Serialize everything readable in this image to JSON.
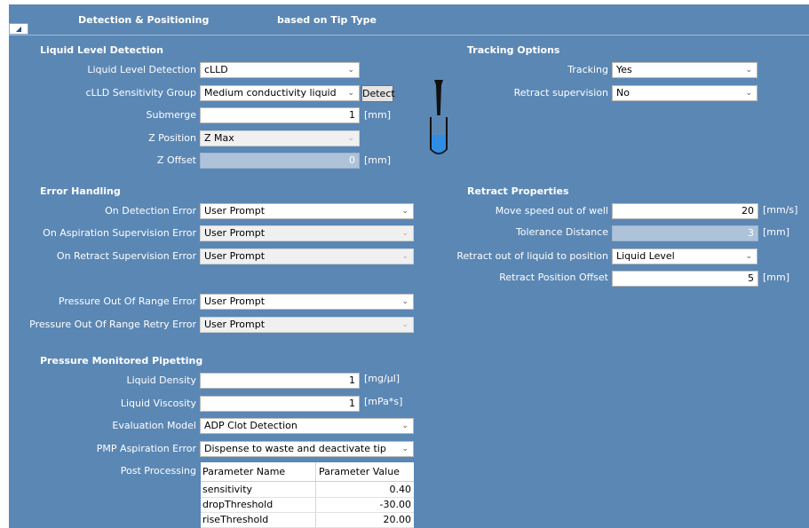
{
  "header": {
    "title": "Detection & Positioning",
    "subtitle": "based on Tip Type",
    "collapse_glyph": "◢"
  },
  "lld": {
    "section": "Liquid Level Detection",
    "detection_label": "Liquid Level Detection",
    "detection_value": "cLLD",
    "sensitivity_label": "cLLD Sensitivity Group",
    "sensitivity_value": "Medium conductivity liquid",
    "detect_button": "Detect",
    "submerge_label": "Submerge",
    "submerge_value": "1",
    "submerge_unit": "[mm]",
    "zpos_label": "Z Position",
    "zpos_value": "Z Max",
    "zoffset_label": "Z Offset",
    "zoffset_value": "0",
    "zoffset_unit": "[mm]"
  },
  "tracking": {
    "section": "Tracking Options",
    "tracking_label": "Tracking",
    "tracking_value": "Yes",
    "retract_sup_label": "Retract supervision",
    "retract_sup_value": "No"
  },
  "errors": {
    "section": "Error Handling",
    "items": [
      {
        "label": "On Detection Error",
        "value": "User Prompt"
      },
      {
        "label": "On Aspiration Supervision Error",
        "value": "User Prompt"
      },
      {
        "label": "On Retract Supervision Error",
        "value": "User Prompt"
      },
      {
        "label": "Pressure Out Of Range Error",
        "value": "User Prompt"
      },
      {
        "label": "Pressure Out Of Range Retry Error",
        "value": "User Prompt"
      }
    ]
  },
  "retract": {
    "section": "Retract Properties",
    "speed_label": "Move speed out of well",
    "speed_value": "20",
    "speed_unit": "[mm/s]",
    "tolerance_label": "Tolerance Distance",
    "tolerance_value": "3",
    "tolerance_unit": "[mm]",
    "position_label": "Retract out of liquid to position",
    "position_value": "Liquid Level",
    "offset_label": "Retract Position Offset",
    "offset_value": "5",
    "offset_unit": "[mm]"
  },
  "pmp": {
    "section": "Pressure Monitored Pipetting",
    "density_label": "Liquid Density",
    "density_value": "1",
    "density_unit": "[mg/µl]",
    "viscosity_label": "Liquid Viscosity",
    "viscosity_value": "1",
    "viscosity_unit": "[mPa*s]",
    "model_label": "Evaluation Model",
    "model_value": "ADP Clot Detection",
    "asp_error_label": "PMP Aspiration Error",
    "asp_error_value": "Dispense to waste and deactivate tip",
    "post_label": "Post Processing",
    "table": {
      "headers": [
        "Parameter Name",
        "Parameter Value"
      ],
      "rows": [
        {
          "name": "sensitivity",
          "value": "0.40"
        },
        {
          "name": "dropThreshold",
          "value": "-30.00"
        },
        {
          "name": "riseThreshold",
          "value": "20.00"
        }
      ]
    }
  },
  "icons": {
    "dropdown": "chevron-down-icon",
    "tip": "pipette-tip-icon"
  },
  "colors": {
    "panel": "#5b87b4",
    "liquid": "#2f8de4"
  }
}
